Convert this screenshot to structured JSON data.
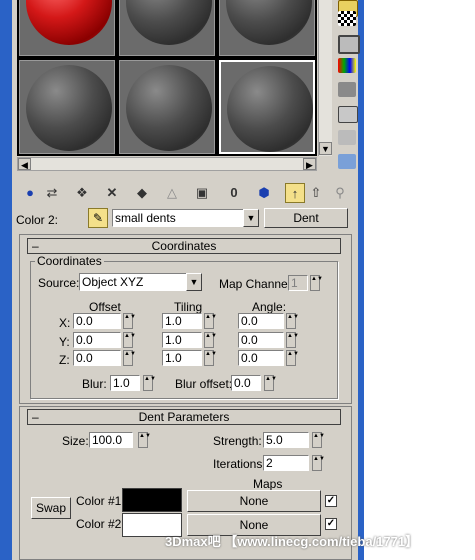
{
  "material_slots": [
    {
      "name": "slot-1",
      "color": "red"
    },
    {
      "name": "slot-2",
      "color": "gray"
    },
    {
      "name": "slot-3",
      "color": "gray"
    },
    {
      "name": "slot-4",
      "color": "gray"
    },
    {
      "name": "slot-5",
      "color": "gray"
    },
    {
      "name": "slot-6",
      "color": "gray"
    }
  ],
  "map_row": {
    "label": "Color 2:",
    "map_name": "small dents",
    "type_button": "Dent"
  },
  "coordinates": {
    "rollout_title": "Coordinates",
    "group_title": "Coordinates",
    "source_label": "Source:",
    "source_value": "Object XYZ",
    "map_channel_label": "Map Channel:",
    "map_channel_value": "1",
    "col_offset": "Offset",
    "col_tiling": "Tiling",
    "col_angle": "Angle:",
    "rows": [
      {
        "axis": "X:",
        "offset": "0.0",
        "tiling": "1.0",
        "angle": "0.0"
      },
      {
        "axis": "Y:",
        "offset": "0.0",
        "tiling": "1.0",
        "angle": "0.0"
      },
      {
        "axis": "Z:",
        "offset": "0.0",
        "tiling": "1.0",
        "angle": "0.0"
      }
    ],
    "blur_label": "Blur:",
    "blur_value": "1.0",
    "blur_offset_label": "Blur offset:",
    "blur_offset_value": "0.0"
  },
  "dent": {
    "rollout_title": "Dent Parameters",
    "size_label": "Size:",
    "size_value": "100.0",
    "strength_label": "Strength:",
    "strength_value": "5.0",
    "iterations_label": "Iterations:",
    "iterations_value": "2",
    "maps_label": "Maps",
    "swap_label": "Swap",
    "color1_label": "Color #1",
    "color1_hex": "#000000",
    "color2_label": "Color #2",
    "color2_hex": "#ffffff",
    "map1_label": "None",
    "map2_label": "None"
  },
  "watermark": "3Dmax吧 【www.linecg.com/tieba/1771】",
  "icons": {
    "toolbar": [
      "get-material-icon",
      "put-to-scene-icon",
      "assign-material-icon",
      "reset-map-icon",
      "make-unique-icon",
      "put-to-library-icon",
      "material-effects-channel-icon",
      "show-map-icon",
      "show-end-result-icon",
      "go-to-parent-icon",
      "go-forward-sibling-icon",
      "pick-from-object-icon",
      "material-map-navigator-icon"
    ],
    "side": [
      "sample-type-icon",
      "backlight-icon",
      "background-icon",
      "sample-uv-tiling-icon",
      "video-color-check-icon",
      "make-preview-icon",
      "options-icon",
      "select-by-material-icon",
      "map-navigator-icon"
    ]
  }
}
